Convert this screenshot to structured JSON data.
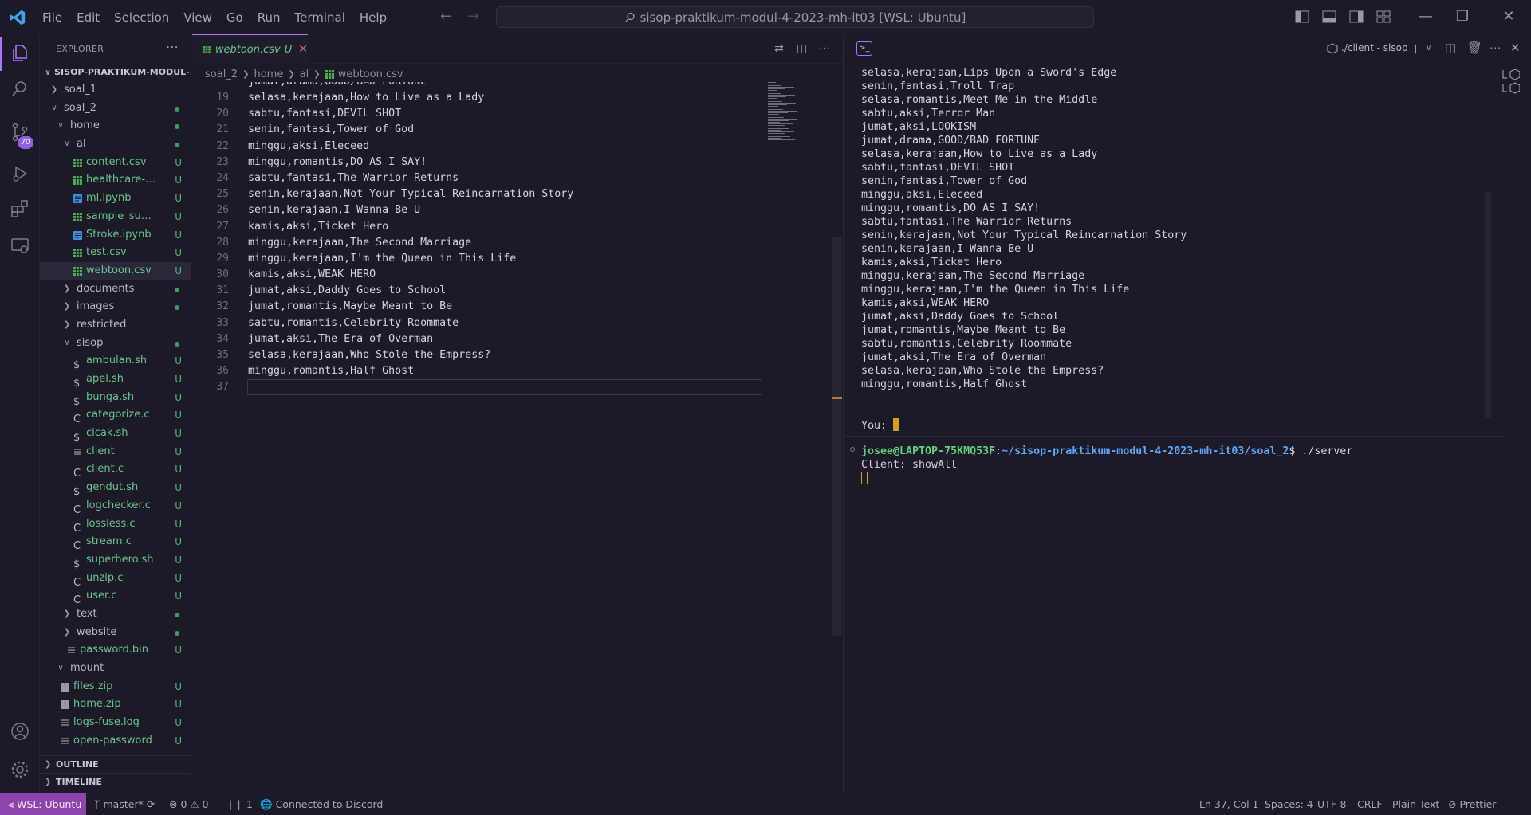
{
  "menu": [
    "File",
    "Edit",
    "Selection",
    "View",
    "Go",
    "Run",
    "Terminal",
    "Help"
  ],
  "command_center": "sisop-praktikum-modul-4-2023-mh-it03 [WSL: Ubuntu]",
  "activity": {
    "scm_badge": "70"
  },
  "explorer": {
    "title": "EXPLORER",
    "workspace": "SISOP-PRAKTIKUM-MODUL-...",
    "tree": [
      {
        "label": "soal_1",
        "depth": 0,
        "type": "folder",
        "open": false,
        "status": ""
      },
      {
        "label": "soal_2",
        "depth": 0,
        "type": "folder",
        "open": true,
        "status": "dot"
      },
      {
        "label": "home",
        "depth": 1,
        "type": "folder",
        "open": true,
        "status": "dot"
      },
      {
        "label": "al",
        "depth": 2,
        "type": "folder",
        "open": true,
        "status": "dot"
      },
      {
        "label": "content.csv",
        "depth": 3,
        "type": "csv",
        "status": "U"
      },
      {
        "label": "healthcare-dat...",
        "depth": 3,
        "type": "csv",
        "status": "U"
      },
      {
        "label": "ml.ipynb",
        "depth": 3,
        "type": "ipynb",
        "status": "U"
      },
      {
        "label": "sample_submi...",
        "depth": 3,
        "type": "csv",
        "status": "U"
      },
      {
        "label": "Stroke.ipynb",
        "depth": 3,
        "type": "ipynb",
        "status": "U"
      },
      {
        "label": "test.csv",
        "depth": 3,
        "type": "csv",
        "status": "U"
      },
      {
        "label": "webtoon.csv",
        "depth": 3,
        "type": "csv",
        "status": "U",
        "active": true
      },
      {
        "label": "documents",
        "depth": 2,
        "type": "folder",
        "open": false,
        "status": "dot"
      },
      {
        "label": "images",
        "depth": 2,
        "type": "folder",
        "open": false,
        "status": "dot"
      },
      {
        "label": "restricted",
        "depth": 2,
        "type": "folder",
        "open": false,
        "status": ""
      },
      {
        "label": "sisop",
        "depth": 2,
        "type": "folder",
        "open": true,
        "status": "dot"
      },
      {
        "label": "ambulan.sh",
        "depth": 3,
        "type": "sh",
        "status": "U"
      },
      {
        "label": "apel.sh",
        "depth": 3,
        "type": "sh",
        "status": "U"
      },
      {
        "label": "bunga.sh",
        "depth": 3,
        "type": "sh",
        "status": "U"
      },
      {
        "label": "categorize.c",
        "depth": 3,
        "type": "c",
        "status": "U"
      },
      {
        "label": "cicak.sh",
        "depth": 3,
        "type": "sh",
        "status": "U"
      },
      {
        "label": "client",
        "depth": 3,
        "type": "bin",
        "status": "U"
      },
      {
        "label": "client.c",
        "depth": 3,
        "type": "c",
        "status": "U"
      },
      {
        "label": "gendut.sh",
        "depth": 3,
        "type": "sh",
        "status": "U"
      },
      {
        "label": "logchecker.c",
        "depth": 3,
        "type": "c",
        "status": "U"
      },
      {
        "label": "lossless.c",
        "depth": 3,
        "type": "c",
        "status": "U"
      },
      {
        "label": "stream.c",
        "depth": 3,
        "type": "c",
        "status": "U"
      },
      {
        "label": "superhero.sh",
        "depth": 3,
        "type": "sh",
        "status": "U"
      },
      {
        "label": "unzip.c",
        "depth": 3,
        "type": "c",
        "status": "U"
      },
      {
        "label": "user.c",
        "depth": 3,
        "type": "c",
        "status": "U"
      },
      {
        "label": "text",
        "depth": 2,
        "type": "folder",
        "open": false,
        "status": "dot"
      },
      {
        "label": "website",
        "depth": 2,
        "type": "folder",
        "open": false,
        "status": "dot"
      },
      {
        "label": "password.bin",
        "depth": 2,
        "type": "bin",
        "status": "U"
      },
      {
        "label": "mount",
        "depth": 1,
        "type": "folder",
        "open": true,
        "status": ""
      },
      {
        "label": "files.zip",
        "depth": 1,
        "type": "zip",
        "status": "U"
      },
      {
        "label": "home.zip",
        "depth": 1,
        "type": "zip",
        "status": "U"
      },
      {
        "label": "logs-fuse.log",
        "depth": 1,
        "type": "bin",
        "status": "U"
      },
      {
        "label": "open-password",
        "depth": 1,
        "type": "bin",
        "status": "U"
      }
    ],
    "outline": "OUTLINE",
    "timeline": "TIMELINE"
  },
  "editor": {
    "tab_label": "webtoon.csv",
    "tab_status": "U",
    "breadcrumbs": [
      "soal_2",
      "home",
      "al",
      "webtoon.csv"
    ],
    "partial_top": "jumat,drama,GOOD/BAD FORTUNE",
    "lines": [
      {
        "n": "19",
        "t": "selasa,kerajaan,How to Live as a Lady"
      },
      {
        "n": "20",
        "t": "sabtu,fantasi,DEVIL SHOT"
      },
      {
        "n": "21",
        "t": "senin,fantasi,Tower of God"
      },
      {
        "n": "22",
        "t": "minggu,aksi,Eleceed"
      },
      {
        "n": "23",
        "t": "minggu,romantis,DO AS I SAY!"
      },
      {
        "n": "24",
        "t": "sabtu,fantasi,The Warrior Returns"
      },
      {
        "n": "25",
        "t": "senin,kerajaan,Not Your Typical Reincarnation Story"
      },
      {
        "n": "26",
        "t": "senin,kerajaan,I Wanna Be U"
      },
      {
        "n": "27",
        "t": "kamis,aksi,Ticket Hero"
      },
      {
        "n": "28",
        "t": "minggu,kerajaan,The Second Marriage"
      },
      {
        "n": "29",
        "t": "minggu,kerajaan,I'm the Queen in This Life"
      },
      {
        "n": "30",
        "t": "kamis,aksi,WEAK HERO"
      },
      {
        "n": "31",
        "t": "jumat,aksi,Daddy Goes to School"
      },
      {
        "n": "32",
        "t": "jumat,romantis,Maybe Meant to Be"
      },
      {
        "n": "33",
        "t": "sabtu,romantis,Celebrity Roommate"
      },
      {
        "n": "34",
        "t": "jumat,aksi,The Era of Overman"
      },
      {
        "n": "35",
        "t": "selasa,kerajaan,Who Stole the Empress?"
      },
      {
        "n": "36",
        "t": "minggu,romantis,Half Ghost"
      },
      {
        "n": "37",
        "t": ""
      }
    ]
  },
  "terminal": {
    "name": "./client - sisop",
    "client_lines": [
      "selasa,kerajaan,Lips Upon a Sword's Edge",
      "senin,fantasi,Troll Trap",
      "selasa,romantis,Meet Me in the Middle",
      "sabtu,aksi,Terror Man",
      "jumat,aksi,LOOKISM",
      "jumat,drama,GOOD/BAD FORTUNE",
      "selasa,kerajaan,How to Live as a Lady",
      "sabtu,fantasi,DEVIL SHOT",
      "senin,fantasi,Tower of God",
      "minggu,aksi,Eleceed",
      "minggu,romantis,DO AS I SAY!",
      "sabtu,fantasi,The Warrior Returns",
      "senin,kerajaan,Not Your Typical Reincarnation Story",
      "senin,kerajaan,I Wanna Be U",
      "kamis,aksi,Ticket Hero",
      "minggu,kerajaan,The Second Marriage",
      "minggu,kerajaan,I'm the Queen in This Life",
      "kamis,aksi,WEAK HERO",
      "jumat,aksi,Daddy Goes to School",
      "jumat,romantis,Maybe Meant to Be",
      "sabtu,romantis,Celebrity Roommate",
      "jumat,aksi,The Era of Overman",
      "selasa,kerajaan,Who Stole the Empress?",
      "minggu,romantis,Half Ghost"
    ],
    "client_prompt": "You: ",
    "server_user": "josee@LAPTOP-75KMQ53F",
    "server_path": "~/sisop-praktikum-modul-4-2023-mh-it03/soal_2",
    "server_cmd": "$ ./server",
    "server_output": "Client: showAll"
  },
  "status": {
    "remote": "WSL: Ubuntu",
    "branch": "master*",
    "errors": "0",
    "warnings": "0",
    "ports": "1",
    "discord": "Connected to Discord",
    "position": "Ln 37, Col 1",
    "spaces": "Spaces: 4",
    "encoding": "UTF-8",
    "eol": "CRLF",
    "language": "Plain Text",
    "formatter": "Prettier"
  },
  "colors": {
    "accent": "#a876ff",
    "remote_bg": "#8e44ad",
    "untracked": "#67c58f",
    "cursor": "#d4a017"
  }
}
